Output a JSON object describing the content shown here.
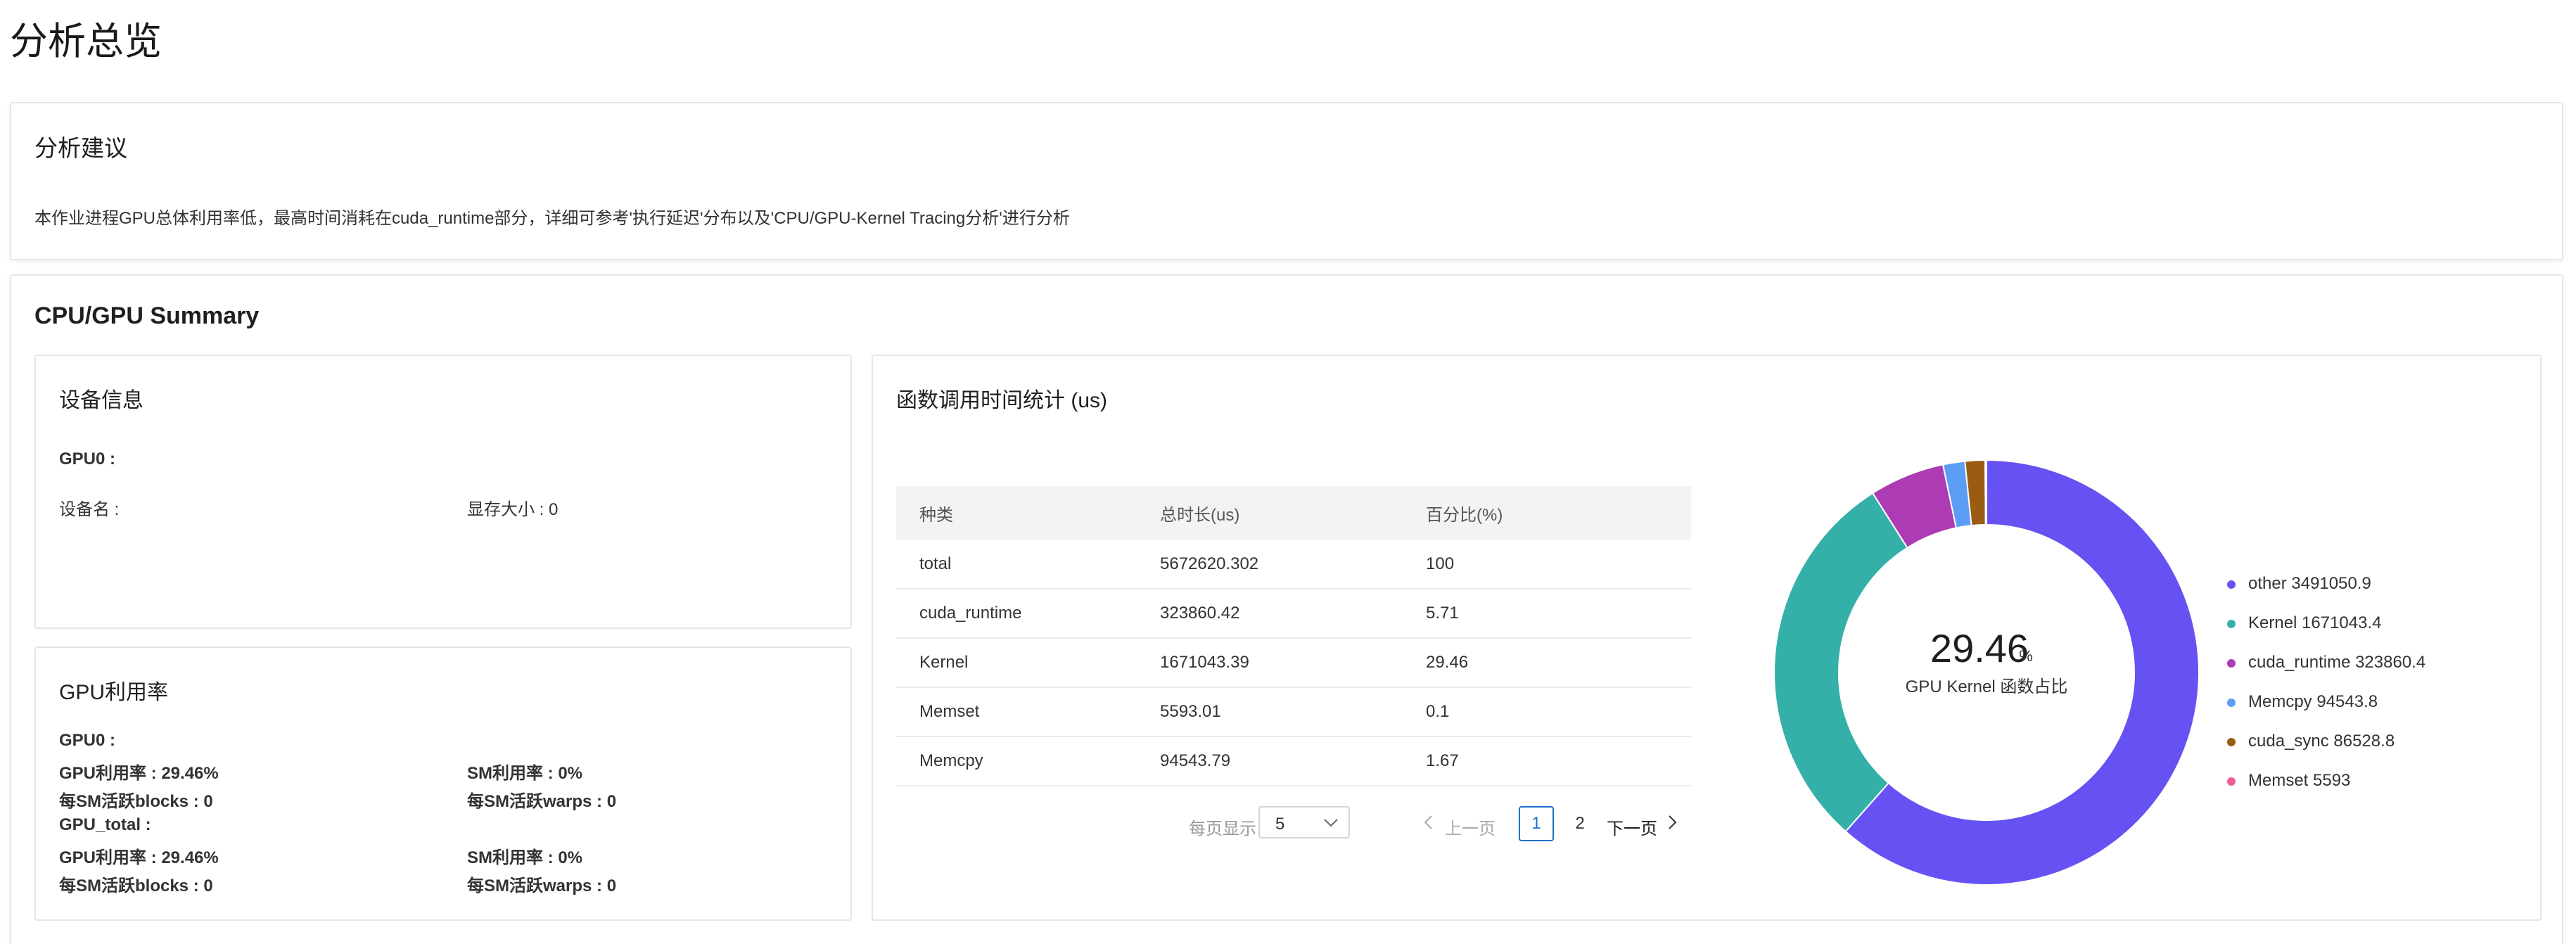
{
  "page_title": "分析总览",
  "advice": {
    "title": "分析建议",
    "text": "本作业进程GPU总体利用率低，最高时间消耗在cuda_runtime部分，详细可参考'执行延迟'分布以及'CPU/GPU-Kernel Tracing分析'进行分析"
  },
  "summary": {
    "title": "CPU/GPU Summary",
    "device": {
      "title": "设备信息",
      "gpu_label": "GPU0 :",
      "device_name_label": "设备名 :",
      "memory_label": "显存大小 : 0"
    },
    "utilization": {
      "title": "GPU利用率",
      "gpu0": {
        "label": "GPU0 :",
        "gpu_util": "GPU利用率 : 29.46%",
        "sm_util": "SM利用率 : 0%",
        "sm_blocks": "每SM活跃blocks : 0",
        "sm_warps": "每SM活跃warps : 0"
      },
      "gpu_total": {
        "label": "GPU_total :",
        "gpu_util": "GPU利用率 : 29.46%",
        "sm_util": "SM利用率 : 0%",
        "sm_blocks": "每SM活跃blocks : 0",
        "sm_warps": "每SM活跃warps : 0"
      }
    },
    "function_stats": {
      "title": "函数调用时间统计 (us)",
      "columns": [
        "种类",
        "总时长(us)",
        "百分比(%)"
      ],
      "rows": [
        [
          "total",
          "5672620.302",
          "100"
        ],
        [
          "cuda_runtime",
          "323860.42",
          "5.71"
        ],
        [
          "Kernel",
          "1671043.39",
          "29.46"
        ],
        [
          "Memset",
          "5593.01",
          "0.1"
        ],
        [
          "Memcpy",
          "94543.79",
          "1.67"
        ]
      ],
      "pagination": {
        "page_size_label": "每页显示",
        "page_size": "5",
        "prev_label": "上一页",
        "pages": [
          "1",
          "2"
        ],
        "current_page": "1",
        "next_label": "下一页"
      },
      "donut": {
        "center_value": "29.46",
        "center_unit": "%",
        "center_label": "GPU Kernel 函数占比"
      }
    }
  },
  "chart_data": {
    "type": "pie",
    "series": [
      {
        "name": "other",
        "value": 3491050.9,
        "label": "other  3491050.9",
        "color": "#6652f2"
      },
      {
        "name": "Kernel",
        "value": 1671043.4,
        "label": "Kernel  1671043.4",
        "color": "#34b0a8"
      },
      {
        "name": "cuda_runtime",
        "value": 323860.4,
        "label": "cuda_runtime  323860.4",
        "color": "#ad3bb4"
      },
      {
        "name": "Memcpy",
        "value": 94543.8,
        "label": "Memcpy  94543.8",
        "color": "#5c9ef6"
      },
      {
        "name": "cuda_sync",
        "value": 86528.8,
        "label": "cuda_sync  86528.8",
        "color": "#9a5c12"
      },
      {
        "name": "Memset",
        "value": 5593,
        "label": "Memset  5593",
        "color": "#ec5f96"
      }
    ],
    "legend_position": "right"
  }
}
